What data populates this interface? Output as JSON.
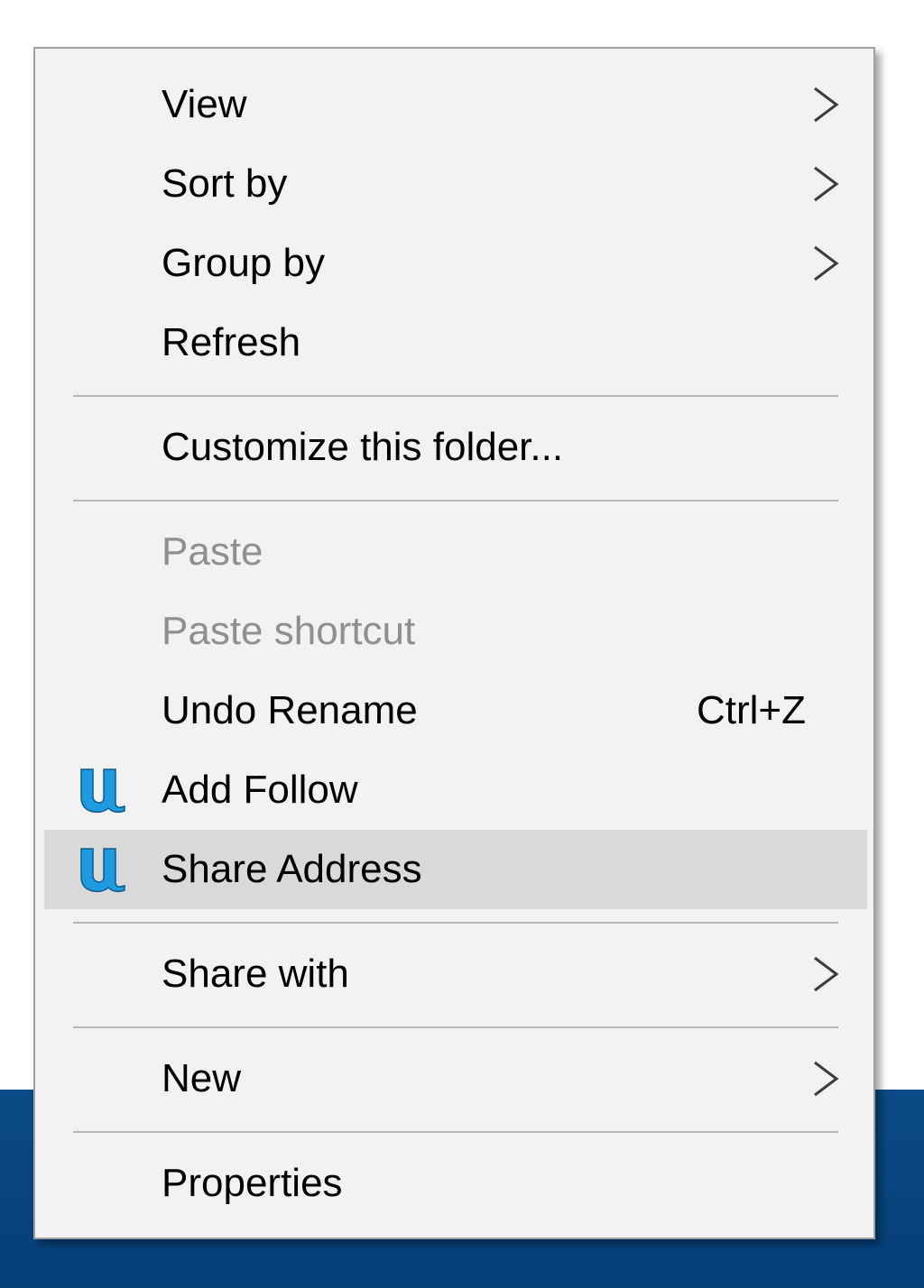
{
  "menu": {
    "items": [
      {
        "label": "View",
        "submenu": true
      },
      {
        "label": "Sort by",
        "submenu": true
      },
      {
        "label": "Group by",
        "submenu": true
      },
      {
        "label": "Refresh"
      },
      {
        "label": "Customize this folder..."
      },
      {
        "label": "Paste",
        "disabled": true
      },
      {
        "label": "Paste shortcut",
        "disabled": true
      },
      {
        "label": "Undo Rename",
        "shortcut": "Ctrl+Z"
      },
      {
        "label": "Add Follow",
        "icon": "u-app-icon"
      },
      {
        "label": "Share Address",
        "icon": "u-app-icon",
        "highlighted": true
      },
      {
        "label": "Share with",
        "submenu": true
      },
      {
        "label": "New",
        "submenu": true
      },
      {
        "label": "Properties"
      }
    ]
  },
  "colors": {
    "menu_background": "#f2f2f2",
    "highlight": "#d9d9d9",
    "disabled_text": "#8f8f8f",
    "icon_blue": "#1e9be0",
    "desktop_blue": "#0b4a86"
  }
}
